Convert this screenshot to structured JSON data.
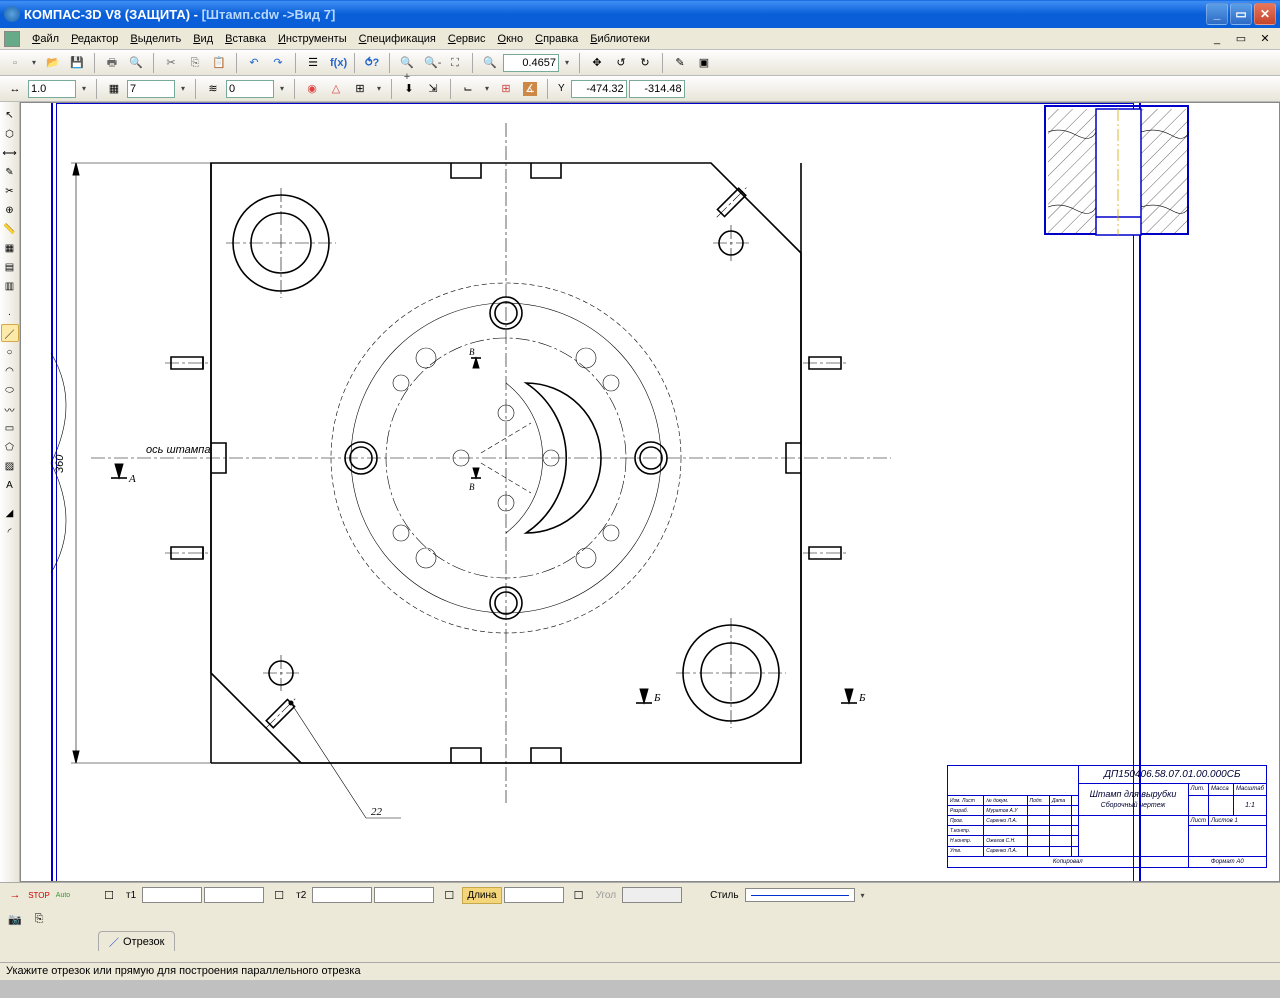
{
  "app": {
    "title_prefix": "КОМПАС-3D V8 (ЗАЩИТА) - ",
    "doc_title": "[Штамп.cdw ->Вид 7]"
  },
  "menu": [
    "Файл",
    "Редактор",
    "Выделить",
    "Вид",
    "Вставка",
    "Инструменты",
    "Спецификация",
    "Сервис",
    "Окно",
    "Справка",
    "Библиотеки"
  ],
  "toolbar1": {
    "zoom_value": "0.4657"
  },
  "toolbar2": {
    "step_value": "1.0",
    "layer_value": "7",
    "level_value": "0",
    "coord_x_label": "Y",
    "coord_x": "-474.32",
    "coord_y": "-314.48"
  },
  "prop_panel": {
    "t1_label": "т1",
    "t1_x": "",
    "t1_y": "",
    "t2_label": "т2",
    "t2_x": "",
    "t2_y": "",
    "len_label": "Длина",
    "len_val": "",
    "ang_label": "Угол",
    "ang_val": "",
    "style_label": "Стиль",
    "tab_label": "Отрезок"
  },
  "status": "Укажите отрезок или прямую для построения параллельного отрезка",
  "title_block": {
    "code": "ДП150406.58.07.01.00.000СБ",
    "name1": "Штамп для вырубки",
    "name2": "Сборочный чертеж",
    "lit": "Лит.",
    "massa": "Масса",
    "masht": "Масштаб",
    "scale": "1:1",
    "list": "Лист",
    "listov": "Листов 1",
    "format": "Формат    А0",
    "kopiraval": "Копировал",
    "row_izm": "Изм. Лист",
    "row_ndok": "№ докум.",
    "row_podp": "Подп.",
    "row_data": "Дата",
    "row_razrab": "Разраб.",
    "row_prov": "Пров.",
    "row_tkontr": "Т.контр.",
    "row_nkontr": "Н.контр.",
    "row_utv": "Утв.",
    "name_razrab": "Муратов А.У",
    "name_prov": "Саренко Л.А.",
    "name_nkontr": "Ожегов С.Н.",
    "name_utv": "Саренко Л.А."
  },
  "drawing_labels": {
    "axis_label": "ось штампа",
    "dim360": "360",
    "secA": "А",
    "secB": "Б",
    "secV": "В",
    "pos22": "22"
  }
}
